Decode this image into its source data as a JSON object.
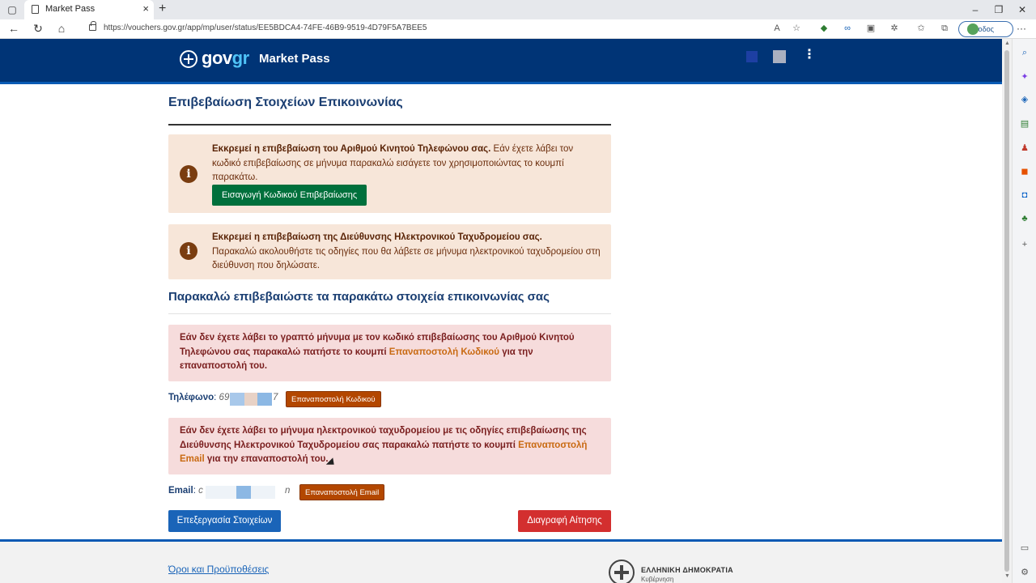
{
  "browser": {
    "tab_title": "Market Pass",
    "url": "https://vouchers.gov.gr/app/mp/user/status/EE5BDCA4-74FE-46B9-9519-4D79F5A7BEE5",
    "signin_label": "Είσοδος"
  },
  "header": {
    "logo_gov": "gov",
    "logo_gr": "gr",
    "site_title": "Market Pass"
  },
  "main": {
    "page_title": "Επιβεβαίωση Στοιχείων Επικοινωνίας",
    "phone_notice": {
      "bold": "Εκκρεμεί η επιβεβαίωση του Αριθμού Κινητού Τηλεφώνου σας.",
      "text": " Εάν έχετε λάβει τον κωδικό επιβεβαίωσης σε μήνυμα παρακαλώ εισάγετε τον χρησιμοποιώντας το κουμπί παρακάτω.",
      "button": "Εισαγωγή Κωδικού Επιβεβαίωσης"
    },
    "email_notice": {
      "bold": "Εκκρεμεί η επιβεβαίωση της Διεύθυνσης Ηλεκτρονικού Ταχυδρομείου σας.",
      "text": "Παρακαλώ ακολουθήστε τις οδηγίες που θα λάβετε σε μήνυμα ηλεκτρονικού ταχυδρομείου στη διεύθυνση που δηλώσατε."
    },
    "confirm_title": "Παρακαλώ επιβεβαιώστε τα παρακάτω στοιχεία επικοινωνίας σας",
    "phone_resend_notice": {
      "before": "Εάν δεν έχετε λάβει το γραπτό μήνυμα με τον κωδικό επιβεβαίωσης του Αριθμού Κινητού Τηλεφώνου σας παρακαλώ πατήστε το κουμπί ",
      "highlight": "Επαναποστολή Κωδικού",
      "after": " για την επαναποστολή του."
    },
    "phone_field": {
      "label": "Τηλέφωνο",
      "value_start": "69",
      "value_end": "7",
      "button": "Επαναποστολή Κωδικού"
    },
    "email_resend_notice": {
      "before": "Εάν δεν έχετε λάβει το μήνυμα ηλεκτρονικού ταχυδρομείου με τις οδηγίες επιβεβαίωσης της Διεύθυνσης Ηλεκτρονικού Ταχυδρομείου σας παρακαλώ πατήστε το κουμπί ",
      "highlight": "Επαναποστολή Email",
      "after": " για την επαναποστολή του."
    },
    "email_field": {
      "label": "Email",
      "value_start": "c",
      "value_end": "n",
      "button": "Επαναποστολή Email"
    },
    "edit_button": "Επεξεργασία Στοιχείων",
    "delete_button": "Διαγραφή Αίτησης"
  },
  "footer": {
    "terms_link": "Όροι και Προϋποθέσεις",
    "republic": "ΕΛΛΗΝΙΚΗ ΔΗΜΟΚΡΑΤΙΑ",
    "government": "Κυβέρνηση"
  },
  "colors": {
    "header_bg": "#003476",
    "info_bg": "#f7e6d9",
    "warn_bg": "#f6dcdc",
    "green_button": "#00703c",
    "orange_button": "#b34700",
    "blue_button": "#1a64b8",
    "red_button": "#d32f2f"
  }
}
